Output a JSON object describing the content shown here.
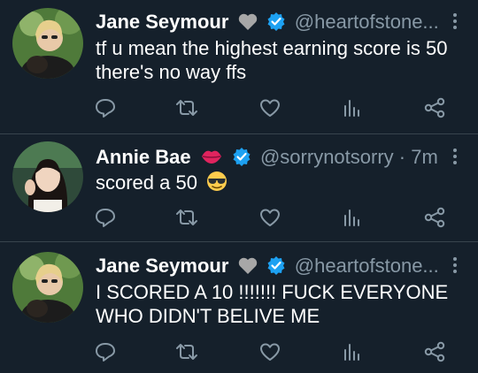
{
  "tweets": [
    {
      "name": "Jane Seymour",
      "handle": "@heartofstone...",
      "name_emoji": "grey-heart",
      "text": "tf u mean the highest earning score is 50 there's no way ffs",
      "body_emoji": ""
    },
    {
      "name": "Annie Bae",
      "handle": "@sorrynotsorry · 7m",
      "name_emoji": "kiss-lips",
      "text": "scored a 50",
      "body_emoji": "sunglasses-face"
    },
    {
      "name": "Jane Seymour",
      "handle": "@heartofstone...",
      "name_emoji": "grey-heart",
      "text": "I SCORED A 10 !!!!!!! FUCK EVERYONE WHO DIDN'T BELIVE ME",
      "body_emoji": ""
    }
  ],
  "colors": {
    "background": "#15202b",
    "name": "#ffffff",
    "muted": "#8899a6",
    "verified": "#1da1f2",
    "divider": "#38444d"
  },
  "icons": [
    "reply-icon",
    "retweet-icon",
    "like-icon",
    "analytics-icon",
    "share-icon",
    "more-icon",
    "verified-badge-icon"
  ]
}
